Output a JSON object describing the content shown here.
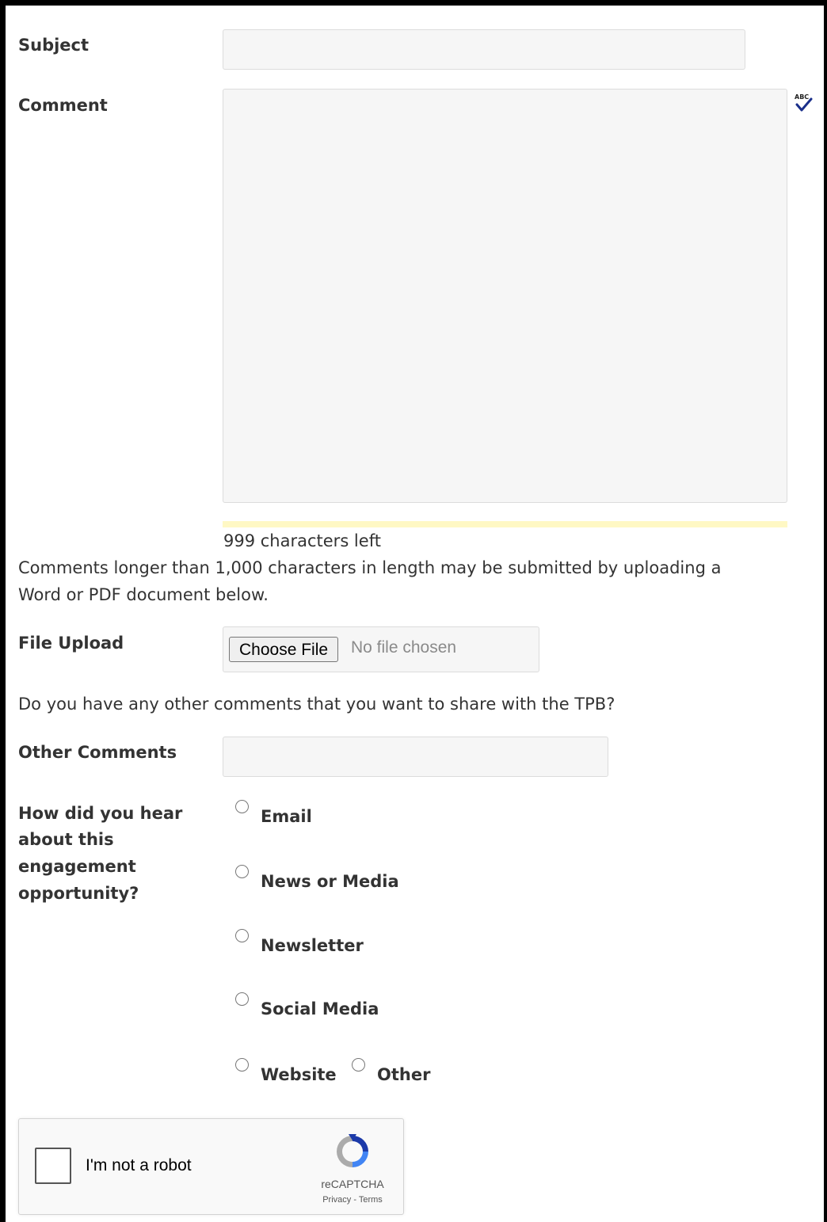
{
  "form": {
    "subject_label": "Subject",
    "subject_value": "",
    "comment_label": "Comment",
    "comment_value": "",
    "spellcheck_icon": "abc-check-icon",
    "chars_left": "999 characters left",
    "long_comment_note_line1": "Comments longer than 1,000 characters in length may be submitted by uploading a",
    "long_comment_note_line2": "Word or PDF document below.",
    "file_upload_label": "File Upload",
    "choose_file_button": "Choose File",
    "no_file_text": "No file chosen",
    "other_comments_prompt": "Do you have any other comments that you want to share with the TPB?",
    "other_comments_label": "Other Comments",
    "other_comments_value": "",
    "hear_label_lines": [
      "How did you hear",
      "about this",
      "engagement",
      "opportunity?"
    ],
    "hear_options": [
      "Email",
      "News or Media",
      "Newsletter",
      "Social Media",
      "Website",
      "Other"
    ],
    "captcha": {
      "checkbox_label": "I'm not a robot",
      "brand": "reCAPTCHA",
      "links": "Privacy - Terms"
    }
  },
  "colors": {
    "counter_bar": "#fff8c4",
    "input_bg": "#f6f6f6"
  }
}
